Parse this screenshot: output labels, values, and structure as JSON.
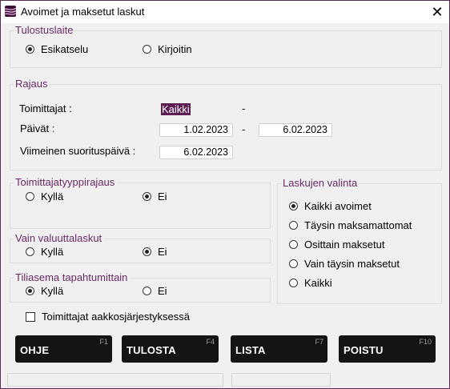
{
  "window": {
    "title": "Avoimet ja maksetut laskut",
    "close_glyph": "✕"
  },
  "output_device": {
    "group_label": "Tulostuslaite",
    "options": [
      {
        "label": "Esikatselu",
        "selected": true
      },
      {
        "label": "Kirjoitin",
        "selected": false
      }
    ]
  },
  "limits": {
    "group_label": "Rajaus",
    "suppliers_label": "Toimittajat :",
    "suppliers_value": "Kaikki",
    "suppliers_dash": "-",
    "dates_label": "Päivät :",
    "date_from": "1.02.2023",
    "date_dash": "-",
    "date_to": "6.02.2023",
    "last_payment_label": "Viimeinen suorituspäivä :",
    "last_payment_date": "6.02.2023"
  },
  "supplier_type_limit": {
    "group_label": "Toimittajatyyppirajaus",
    "options": [
      {
        "label": "Kyllä",
        "selected": false
      },
      {
        "label": "Ei",
        "selected": true
      }
    ]
  },
  "currency_invoices_only": {
    "group_label": "Vain valuuttalaskut",
    "options": [
      {
        "label": "Kyllä",
        "selected": false
      },
      {
        "label": "Ei",
        "selected": true
      }
    ]
  },
  "account_status_by_event": {
    "group_label": "Tiliasema tapahtumittain",
    "options": [
      {
        "label": "Kyllä",
        "selected": true
      },
      {
        "label": "Ei",
        "selected": false
      }
    ]
  },
  "invoice_selection": {
    "group_label": "Laskujen valinta",
    "options": [
      {
        "label": "Kaikki avoimet",
        "selected": true
      },
      {
        "label": "Täysin maksamattomat",
        "selected": false
      },
      {
        "label": "Osittain maksetut",
        "selected": false
      },
      {
        "label": "Vain täysin maksetut",
        "selected": false
      },
      {
        "label": "Kaikki",
        "selected": false
      }
    ]
  },
  "alphabetical": {
    "label": "Toimittajat aakkosjärjestyksessä",
    "checked": false
  },
  "buttons": [
    {
      "label": "OHJE",
      "key": "F1"
    },
    {
      "label": "TULOSTA",
      "key": "F4"
    },
    {
      "label": "LISTA",
      "key": "F7"
    },
    {
      "label": "POISTU",
      "key": "F10"
    }
  ],
  "colors": {
    "accent": "#6a2a66",
    "selection_bg": "#5c1e52",
    "button_bg": "#141414",
    "window_bg": "#f0f0f0"
  }
}
